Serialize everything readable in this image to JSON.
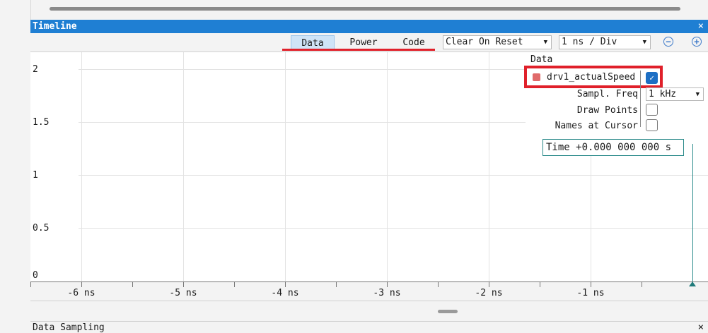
{
  "panel": {
    "title": "Timeline",
    "close_glyph": "×"
  },
  "toolbar": {
    "tabs": [
      "Data",
      "Power",
      "Code"
    ],
    "active_tab": "Data",
    "reset_mode": "Clear On Reset",
    "time_div": "1 ns / Div",
    "zoom_out_glyph": "−",
    "zoom_in_glyph": "+",
    "dropdown_glyph": "▼"
  },
  "legend": {
    "title": "Data",
    "series_name": "drv1_actualSpeed",
    "series_color": "#e06a6a",
    "series_checked": true,
    "check_glyph": "✓",
    "sampl_freq_label": "Sampl. Freq",
    "sampl_freq_value": "1 kHz",
    "draw_points_label": "Draw Points",
    "draw_points_checked": false,
    "names_at_cursor_label": "Names at Cursor",
    "names_at_cursor_checked": false,
    "time_readout": "Time +0.000 000 000 s"
  },
  "chart_data": {
    "type": "line",
    "y_ticks": [
      "2",
      "1.5",
      "1",
      "0.5",
      "0"
    ],
    "x_ticks": [
      "-6 ns",
      "-5 ns",
      "-4 ns",
      "-3 ns",
      "-2 ns",
      "-1 ns"
    ],
    "ylim": [
      0,
      2
    ],
    "grid": true,
    "series": [
      {
        "name": "drv1_actualSpeed",
        "values": []
      }
    ]
  },
  "bottom": {
    "sampling_label": "Data Sampling",
    "close_glyph": "×"
  }
}
